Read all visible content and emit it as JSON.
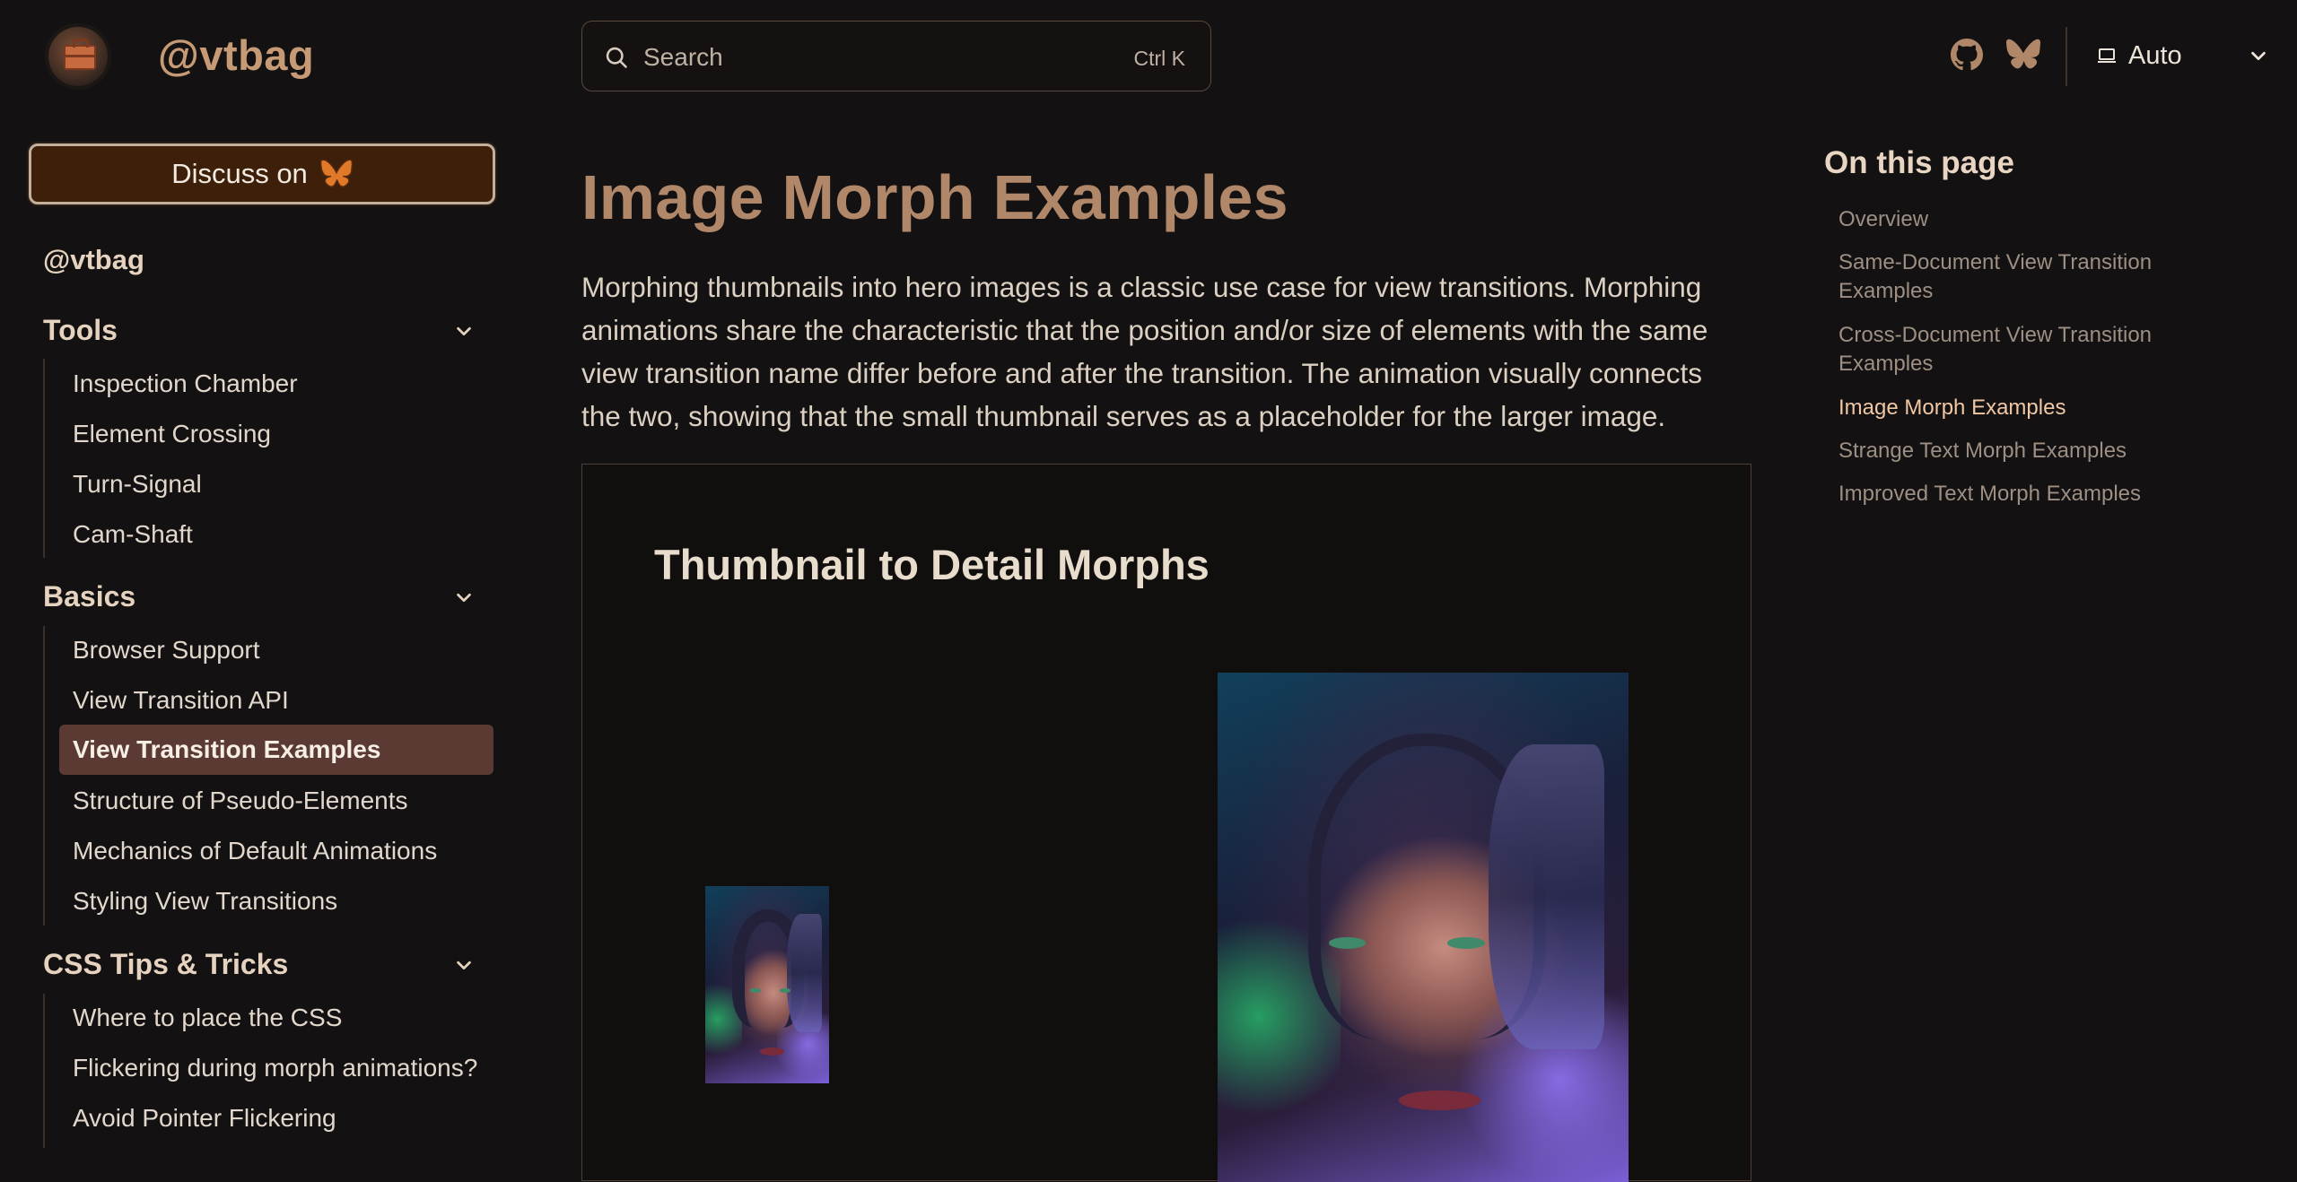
{
  "header": {
    "site_title": "@vtbag",
    "search": {
      "placeholder": "Search",
      "shortcut": "Ctrl K"
    },
    "icons": [
      "github-icon",
      "bluesky-icon"
    ],
    "theme": {
      "label": "Auto"
    }
  },
  "sidebar": {
    "discuss_label": "Discuss on",
    "top_link": "@vtbag",
    "groups": [
      {
        "label": "Tools",
        "items": [
          "Inspection Chamber",
          "Element Crossing",
          "Turn-Signal",
          "Cam-Shaft"
        ]
      },
      {
        "label": "Basics",
        "items": [
          "Browser Support",
          "View Transition API",
          "View Transition Examples",
          "Structure of Pseudo-Elements",
          "Mechanics of Default Animations",
          "Styling View Transitions"
        ]
      },
      {
        "label": "CSS Tips & Tricks",
        "items": [
          "Where to place the CSS",
          "Flickering during morph animations?",
          "Avoid Pointer Flickering"
        ]
      }
    ],
    "active_item": "View Transition Examples"
  },
  "main": {
    "title": "Image Morph Examples",
    "intro": "Morphing thumbnails into hero images is a classic use case for view transitions. Morphing animations share the characteristic that the position and/or size of elements with the same view transition name differ before and after the transition. The animation visually connects the two, showing that the small thumbnail serves as a placeholder for the larger image.",
    "example": {
      "title": "Thumbnail to Detail Morphs"
    }
  },
  "toc": {
    "title": "On this page",
    "items": [
      "Overview",
      "Same-Document View Transition Examples",
      "Cross-Document View Transition Examples",
      "Image Morph Examples",
      "Strange Text Morph Examples",
      "Improved Text Morph Examples"
    ],
    "current": "Image Morph Examples"
  },
  "colors": {
    "background": "#131111",
    "accent": "#c59a75",
    "active_nav": "#5a3a32",
    "toc_current": "#f1c7a4"
  }
}
